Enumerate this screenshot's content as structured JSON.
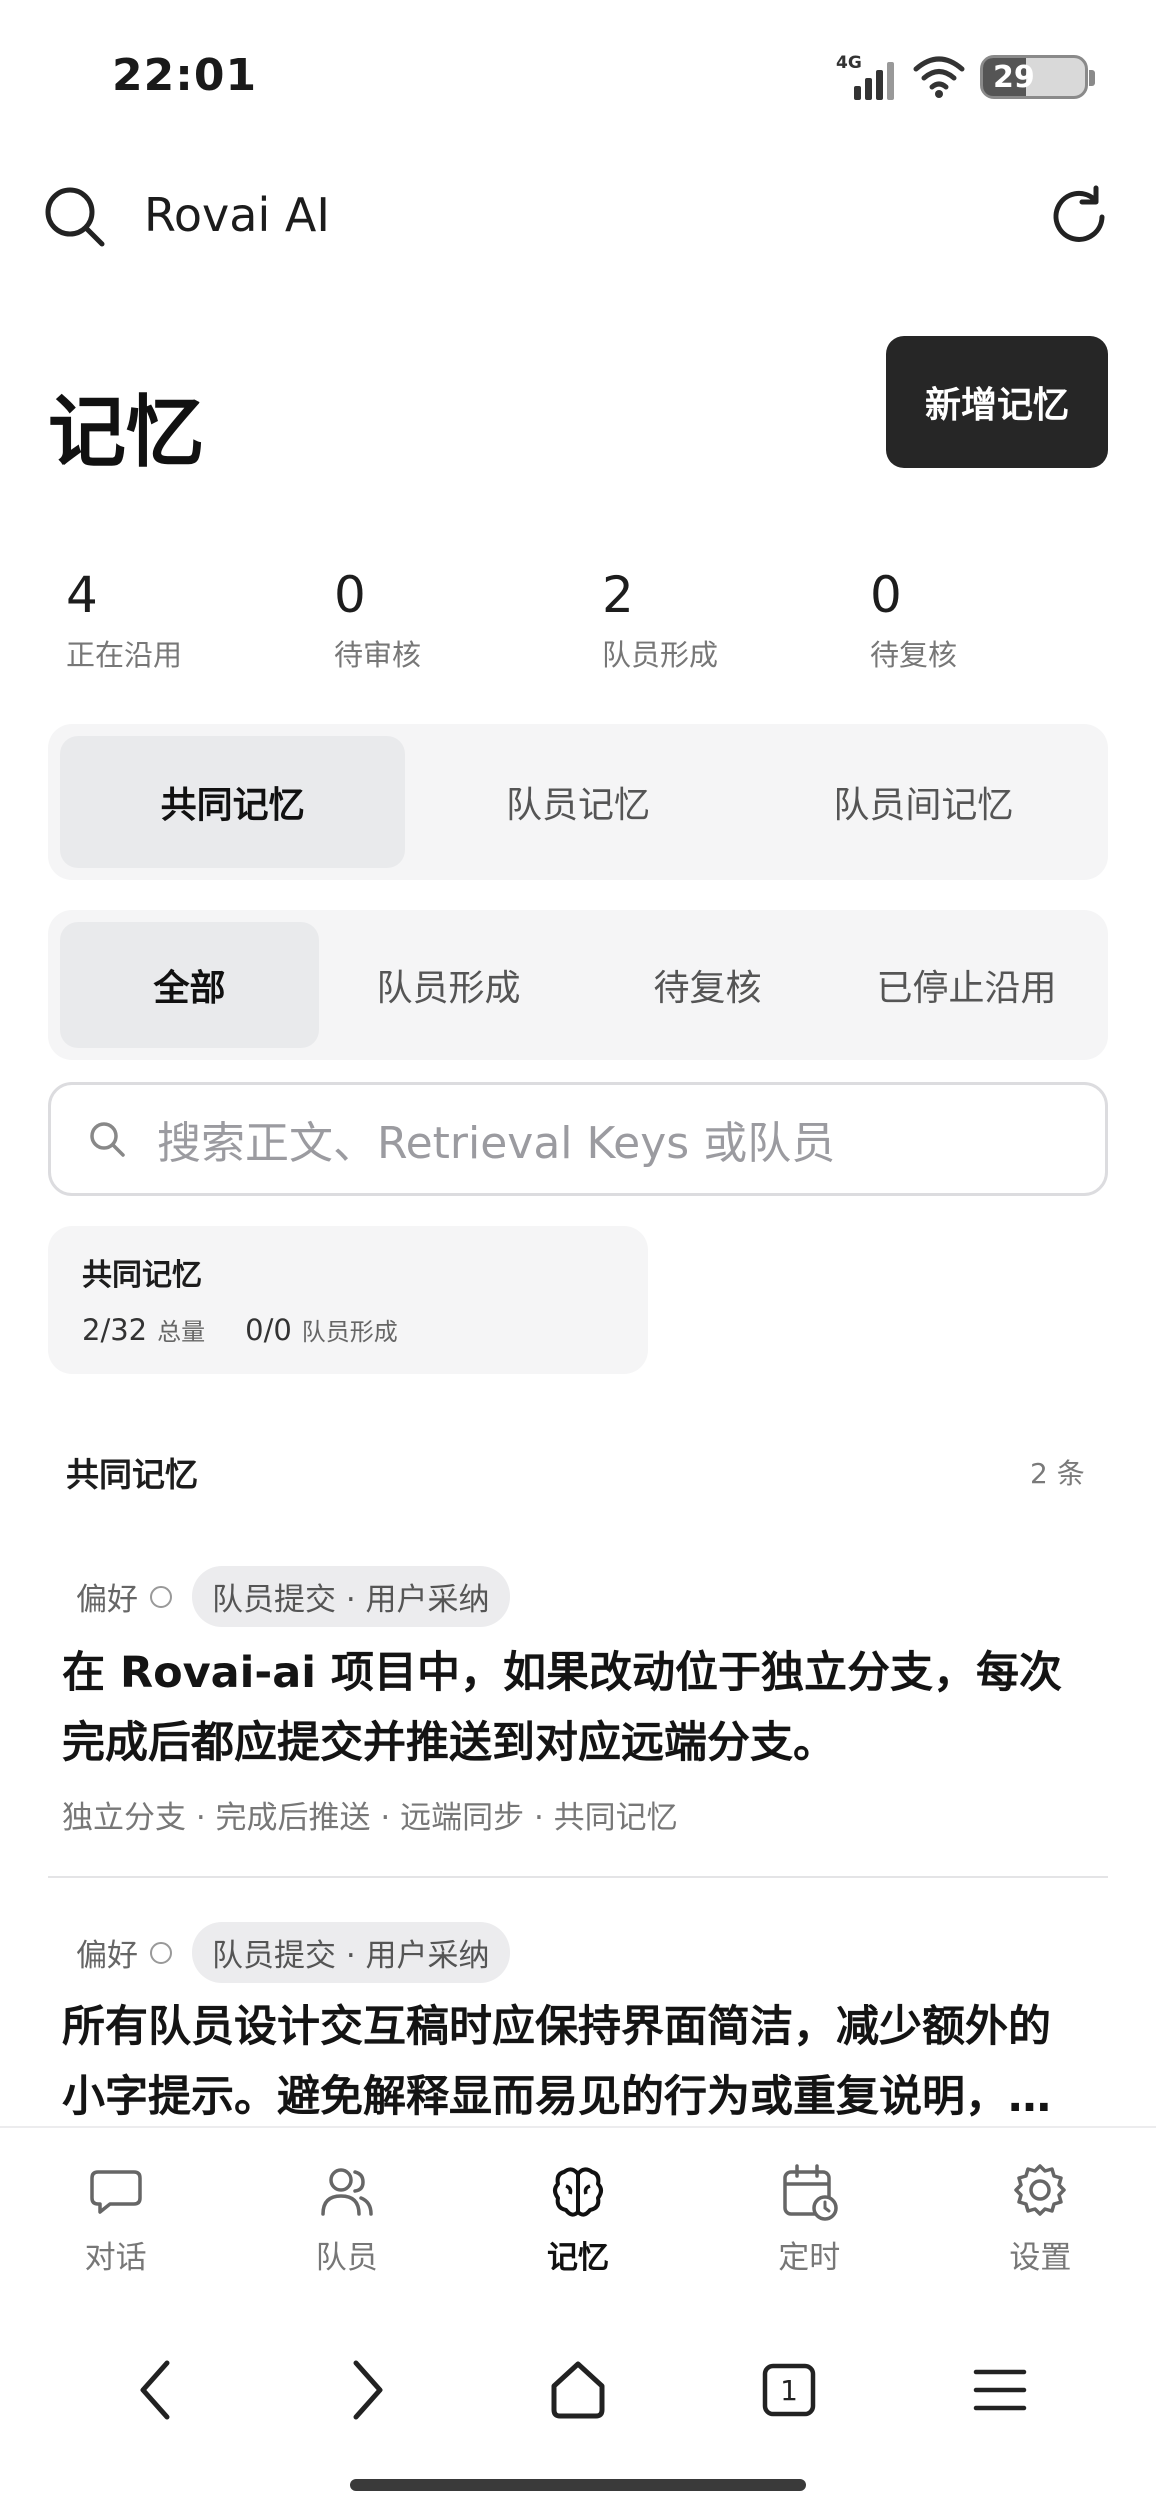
{
  "status_bar": {
    "time": "22:01",
    "network": "4G",
    "battery": "29"
  },
  "topbar": {
    "title": "Rovai AI"
  },
  "page": {
    "title": "记忆",
    "add_button": "新增记忆"
  },
  "stats": [
    {
      "value": "4",
      "label": "正在沿用"
    },
    {
      "value": "0",
      "label": "待审核"
    },
    {
      "value": "2",
      "label": "队员形成"
    },
    {
      "value": "0",
      "label": "待复核"
    }
  ],
  "scope_tabs": [
    "共同记忆",
    "队员记忆",
    "队员间记忆"
  ],
  "filter_tabs": [
    "全部",
    "队员形成",
    "待复核",
    "已停止沿用"
  ],
  "search": {
    "placeholder": "搜索正文、Retrieval Keys 或队员"
  },
  "summary_card": {
    "title": "共同记忆",
    "total_value": "2/32",
    "total_label": "总量",
    "formed_value": "0/0",
    "formed_label": "队员形成"
  },
  "section": {
    "title": "共同记忆",
    "count": "2 条"
  },
  "memories": [
    {
      "type": "偏好",
      "source": "队员提交 · 用户采纳",
      "text_line1": "在 Rovai-ai 项目中，如果改动位于独立分支，每次",
      "text_line2": "完成后都应提交并推送到对应远端分支。",
      "keywords": "独立分支 · 完成后推送 · 远端同步 · 共同记忆"
    },
    {
      "type": "偏好",
      "source": "队员提交 · 用户采纳",
      "text_line1": "所有队员设计交互稿时应保持界面简洁，减少额外的",
      "text_line2": "小字提示。避免解释显而易见的行为或重复说明，…",
      "keywords": ""
    }
  ],
  "bottom_nav": [
    {
      "label": "对话",
      "icon": "chat-bubble-icon"
    },
    {
      "label": "队员",
      "icon": "people-icon"
    },
    {
      "label": "记忆",
      "icon": "brain-icon"
    },
    {
      "label": "定时",
      "icon": "calendar-clock-icon"
    },
    {
      "label": "设置",
      "icon": "gear-icon"
    }
  ],
  "system_nav": {
    "tabs_count": "1"
  }
}
